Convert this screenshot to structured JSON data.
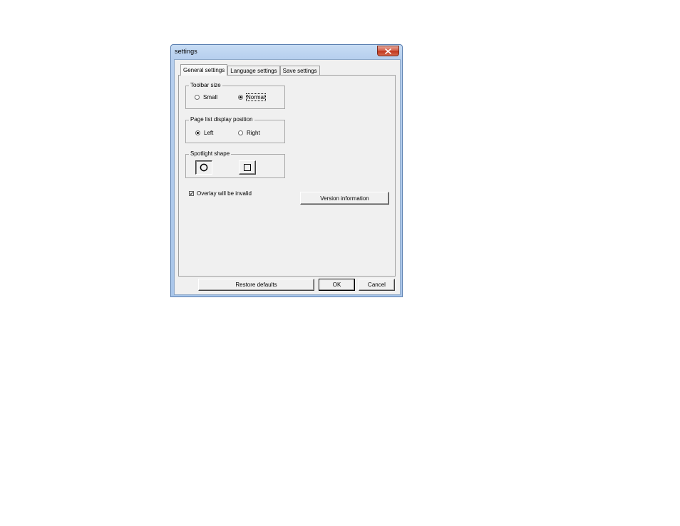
{
  "window": {
    "title": "settings",
    "close_label": "x"
  },
  "tabs": [
    {
      "label": "General settings",
      "active": true
    },
    {
      "label": "Language settings",
      "active": false
    },
    {
      "label": "Save settings",
      "active": false
    }
  ],
  "toolbar_size": {
    "legend": "Toolbar size",
    "options": [
      {
        "label": "Small",
        "checked": false
      },
      {
        "label": "Normal",
        "checked": true
      }
    ]
  },
  "page_list": {
    "legend": "Page list display position",
    "options": [
      {
        "label": "Left",
        "checked": true
      },
      {
        "label": "Right",
        "checked": false
      }
    ]
  },
  "spotlight": {
    "legend": "Spotlight shape",
    "options": [
      {
        "icon": "circle-icon",
        "selected": true
      },
      {
        "icon": "square-icon",
        "selected": false
      }
    ]
  },
  "overlay": {
    "label": "Overlay will be invalid",
    "checked": true
  },
  "buttons": {
    "version_info": "Version information",
    "restore_defaults": "Restore defaults",
    "ok": "OK",
    "cancel": "Cancel"
  }
}
